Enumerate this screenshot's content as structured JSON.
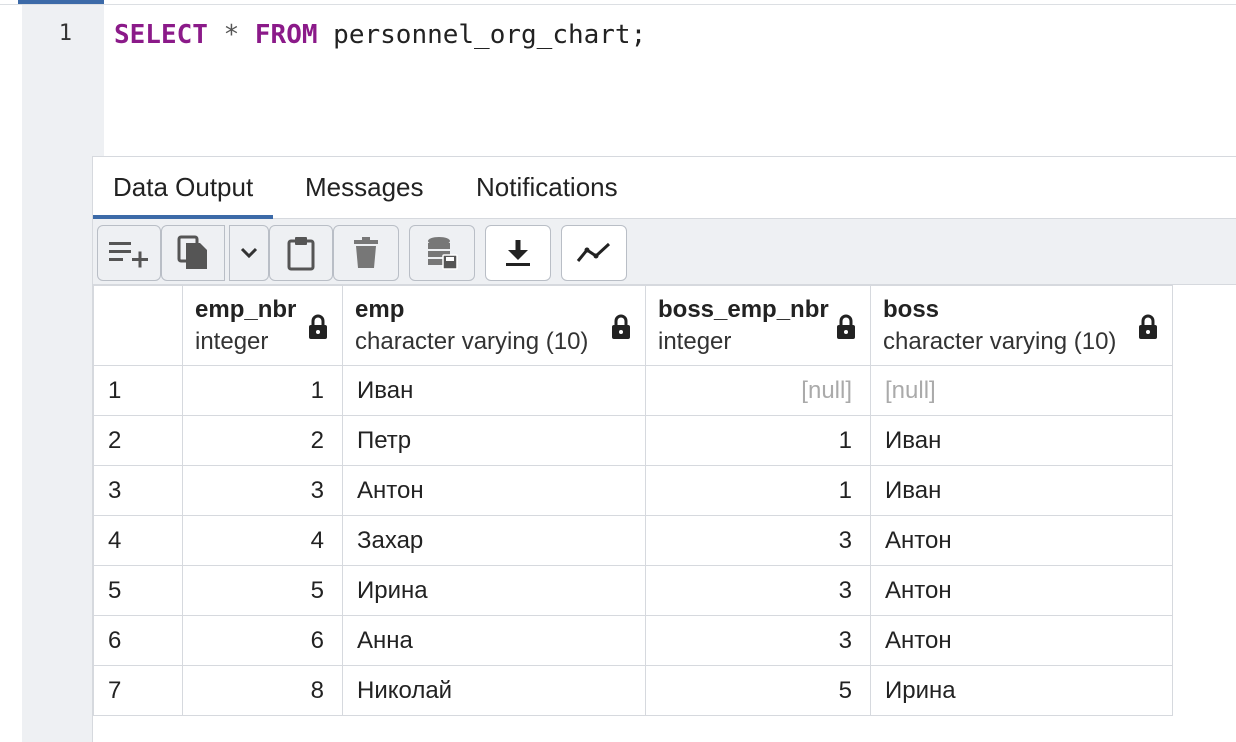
{
  "editor": {
    "line_number": "1",
    "kw_select": "SELECT",
    "star": "*",
    "kw_from": "FROM",
    "rest": "personnel_org_chart;"
  },
  "tabs": [
    {
      "label": "Data Output",
      "active": true
    },
    {
      "label": "Messages",
      "active": false
    },
    {
      "label": "Notifications",
      "active": false
    }
  ],
  "toolbar": {
    "icons": [
      "add-row-icon",
      "copy-icon",
      "chevron-down-icon",
      "paste-icon",
      "delete-icon",
      "save-data-icon",
      "download-icon",
      "graph-icon"
    ]
  },
  "columns": [
    {
      "name": "emp_nbr",
      "type": "integer"
    },
    {
      "name": "emp",
      "type": "character varying (10)"
    },
    {
      "name": "boss_emp_nbr",
      "type": "integer"
    },
    {
      "name": "boss",
      "type": "character varying (10)"
    }
  ],
  "rows": [
    {
      "rn": "1",
      "emp_nbr": "1",
      "emp": "Иван",
      "boss_emp_nbr": "[null]",
      "boss": "[null]"
    },
    {
      "rn": "2",
      "emp_nbr": "2",
      "emp": "Петр",
      "boss_emp_nbr": "1",
      "boss": "Иван"
    },
    {
      "rn": "3",
      "emp_nbr": "3",
      "emp": "Антон",
      "boss_emp_nbr": "1",
      "boss": "Иван"
    },
    {
      "rn": "4",
      "emp_nbr": "4",
      "emp": "Захар",
      "boss_emp_nbr": "3",
      "boss": "Антон"
    },
    {
      "rn": "5",
      "emp_nbr": "5",
      "emp": "Ирина",
      "boss_emp_nbr": "3",
      "boss": "Антон"
    },
    {
      "rn": "6",
      "emp_nbr": "6",
      "emp": "Анна",
      "boss_emp_nbr": "3",
      "boss": "Антон"
    },
    {
      "rn": "7",
      "emp_nbr": "8",
      "emp": "Николай",
      "boss_emp_nbr": "5",
      "boss": "Ирина"
    }
  ],
  "colors": {
    "accent": "#3c6aa8",
    "keyword": "#8b1a89",
    "null_text": "#aaaaaa"
  }
}
